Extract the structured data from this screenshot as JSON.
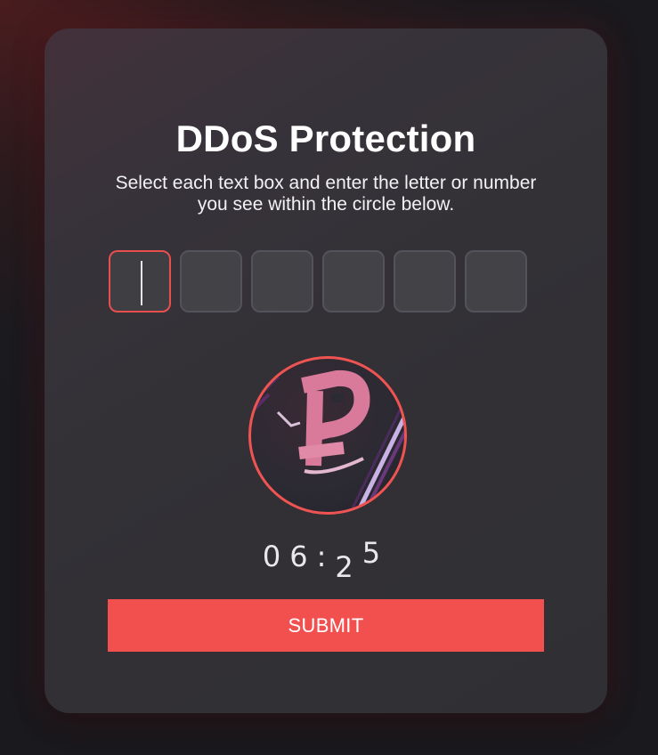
{
  "card": {
    "title": "DDoS Protection",
    "instructions": "Select each text box and enter the letter or number you see within the circle below."
  },
  "code_inputs": [
    {
      "value": ""
    },
    {
      "value": ""
    },
    {
      "value": ""
    },
    {
      "value": ""
    },
    {
      "value": ""
    },
    {
      "value": ""
    }
  ],
  "captcha": {
    "glyph": "P"
  },
  "timer": {
    "digit1": "0",
    "digit2": "6",
    "separator": ":",
    "digit3": "2",
    "digit4": "5"
  },
  "submit_label": "SUBMIT",
  "colors": {
    "accent": "#f1504f",
    "card_bg": "#333136",
    "input_bg": "#434246",
    "input_border": "#53545b",
    "text": "#ffffff"
  }
}
